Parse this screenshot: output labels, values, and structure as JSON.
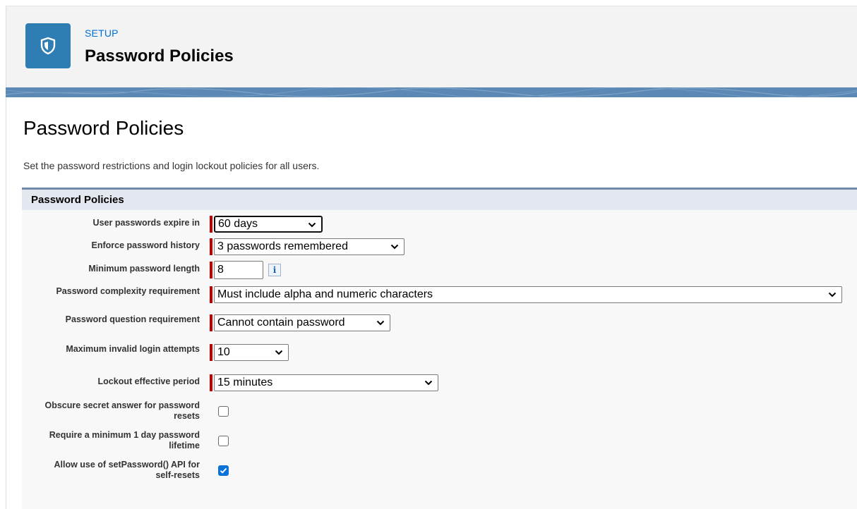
{
  "header": {
    "eyebrow": "SETUP",
    "title": "Password Policies",
    "icon": "shield-icon",
    "icon_bg": "#2e7db3"
  },
  "page": {
    "title": "Password Policies",
    "description": "Set the password restrictions and login lockout policies for all users."
  },
  "section": {
    "title": "Password Policies"
  },
  "fields": {
    "expire": {
      "label": "User passwords expire in",
      "value": "60 days"
    },
    "history": {
      "label": "Enforce password history",
      "value": "3 passwords remembered"
    },
    "min_length": {
      "label": "Minimum password length",
      "value": "8",
      "info_icon": "i"
    },
    "complexity": {
      "label": "Password complexity requirement",
      "value": "Must include alpha and numeric characters"
    },
    "question": {
      "label": "Password question requirement",
      "value": "Cannot contain password"
    },
    "max_invalid": {
      "label": "Maximum invalid login attempts",
      "value": "10"
    },
    "lockout": {
      "label": "Lockout effective period",
      "value": "15 minutes"
    },
    "obscure": {
      "label": "Obscure secret answer for password resets",
      "checked": false
    },
    "min_lifetime": {
      "label": "Require a minimum 1 day password lifetime",
      "checked": false
    },
    "set_password_api": {
      "label": "Allow use of setPassword() API for self-resets",
      "checked": true
    }
  },
  "colors": {
    "required_marker": "#c00000",
    "checkbox_checked": "#0b72d8",
    "link_blue": "#0070d2"
  }
}
